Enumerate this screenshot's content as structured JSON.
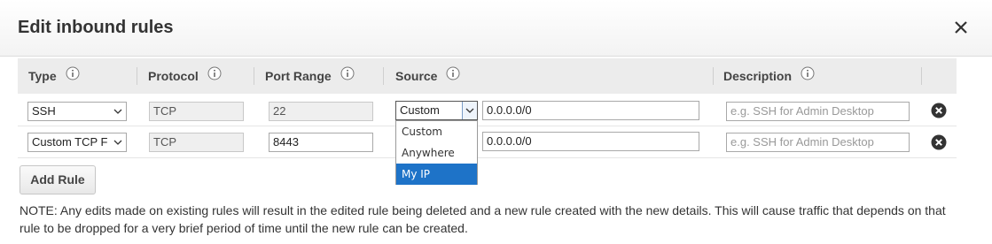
{
  "dialog": {
    "title": "Edit inbound rules"
  },
  "columns": {
    "type": "Type",
    "protocol": "Protocol",
    "port_range": "Port Range",
    "source": "Source",
    "description": "Description"
  },
  "rules": [
    {
      "type": "SSH",
      "protocol": "TCP",
      "port_range": "22",
      "source_type": "Custom",
      "source_value": "0.0.0.0/0",
      "description_placeholder": "e.g. SSH for Admin Desktop"
    },
    {
      "type": "Custom TCP Rule",
      "type_visible": "Custom TCP F",
      "protocol": "TCP",
      "port_range": "8443",
      "source_value": "0.0.0.0/0",
      "description_placeholder": "e.g. SSH for Admin Desktop"
    }
  ],
  "source_dropdown": {
    "options": [
      "Custom",
      "Anywhere",
      "My IP"
    ],
    "highlighted": "My IP"
  },
  "actions": {
    "add_rule": "Add Rule"
  },
  "note": "NOTE: Any edits made on existing rules will result in the edited rule being deleted and a new rule created with the new details. This will cause traffic that depends on that rule to be dropped for a very brief period of time until the new rule can be created.",
  "icons": {
    "close": "close-icon",
    "info": "info-icon",
    "remove": "remove-circle-icon",
    "select": "chevron-down-icon"
  },
  "colors": {
    "highlight": "#1e73c8",
    "header_bg": "#ececec"
  }
}
